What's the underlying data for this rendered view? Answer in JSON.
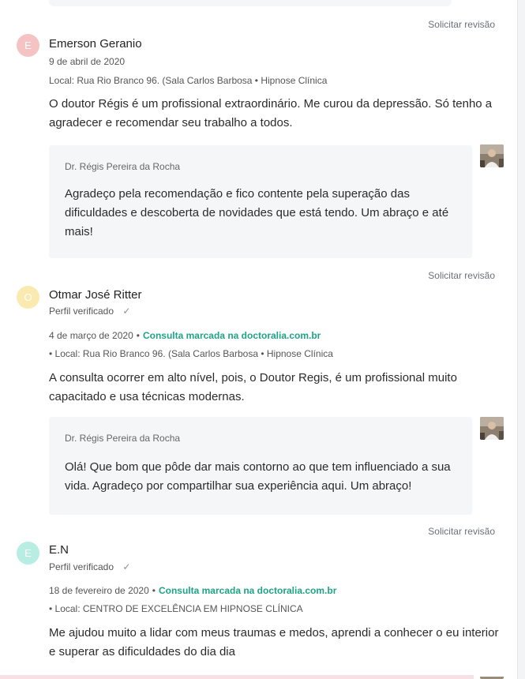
{
  "solicitar_label": "Solicitar revisão",
  "colors": {
    "accent_green": "#1fa386",
    "avatar_pink": "#f5c3c3",
    "avatar_yellow": "#fbeab0",
    "avatar_teal": "#b7ede3"
  },
  "reviews": [
    {
      "avatar_initial": "E",
      "name": "Emerson Geranio",
      "date": "9 de abril de 2020",
      "location": "Local: Rua Rio Branco 96. (Sala Carlos Barbosa • Hipnose Clínica",
      "text_line1": "O doutor Régis é um profissional extraordinário. Me curou da depressão. Só tenho a",
      "text_line2": "agradecer e recomendar seu trabalho a todos.",
      "reply": {
        "doctor": "Dr. Régis Pereira da Rocha",
        "line1": "Agradeço pela recomendação e fico contente pela superação das",
        "line2": "dificuldades e descoberta de novidades que está tendo. Um abraço e até",
        "line3": "mais!"
      }
    },
    {
      "avatar_initial": "O",
      "name": "Otmar José Ritter",
      "verified_label": "Perfil verificado",
      "date": "4 de março de 2020",
      "booked_label": "Consulta marcada na doctoralia.com.br",
      "location": "• Local: Rua Rio Branco 96. (Sala Carlos Barbosa • Hipnose Clínica",
      "text_line1": "A consulta ocorrer em alto nível, pois, o Doutor Regis, é um profissional muito",
      "text_line2": "capacitado e usa técnicas modernas.",
      "reply": {
        "doctor": "Dr. Régis Pereira da Rocha",
        "line1": "Olá! Que bom que pôde dar mais contorno ao que tem influenciado a sua",
        "line2": "vida. Agradeço por compartilhar sua experiência aqui. Um abraço!"
      }
    },
    {
      "avatar_initial": "E",
      "name": "E.N",
      "verified_label": "Perfil verificado",
      "date": "18 de fevereiro de 2020",
      "booked_label": "Consulta marcada na doctoralia.com.br",
      "location": "• Local: CENTRO DE EXCELÊNCIA EM HIPNOSE CLÍNICA",
      "text_line1": "Me ajudou muito a lidar com meus traumas e medos, aprendi a conhecer o eu interior",
      "text_line2": "e superar as dificuldades do dia dia"
    }
  ]
}
